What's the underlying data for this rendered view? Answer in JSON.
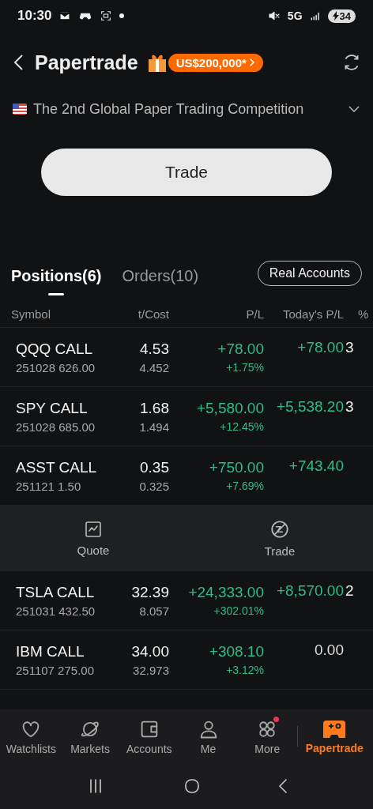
{
  "status_bar": {
    "time": "10:30",
    "network": "5G",
    "battery": "34"
  },
  "header": {
    "title": "Papertrade",
    "promo": "US$200,000*"
  },
  "competition": {
    "title": "The 2nd Global Paper Trading Competition"
  },
  "trade_button": "Trade",
  "tabs": [
    {
      "label": "Positions(6)",
      "selected": true
    },
    {
      "label": "Orders(10)",
      "selected": false
    }
  ],
  "real_accounts_button": "Real Accounts",
  "table": {
    "columns": [
      "Symbol",
      "t/Cost",
      "P/L",
      "Today's P/L",
      "%"
    ],
    "rows": [
      {
        "symbol": "QQQ CALL",
        "contract": "251028 626.00",
        "price": "4.53",
        "cost": "4.452",
        "pl": {
          "value": "+78.00",
          "percent": "+1.75%",
          "color": "#2dbd85"
        },
        "todays_pl": {
          "value": "+78.00",
          "color": "#2dbd85"
        },
        "column_5": "3",
        "expanded": false
      },
      {
        "symbol": "SPY CALL",
        "contract": "251028 685.00",
        "price": "1.68",
        "cost": "1.494",
        "pl": {
          "value": "+5,580.00",
          "percent": "+12.45%",
          "color": "#2dbd85"
        },
        "todays_pl": {
          "value": "+5,538.20",
          "color": "#2dbd85"
        },
        "column_5": "3",
        "expanded": false
      },
      {
        "symbol": "ASST CALL",
        "contract": "251121 1.50",
        "price": "0.35",
        "cost": "0.325",
        "pl": {
          "value": "+750.00",
          "percent": "+7.69%",
          "color": "#2dbd85"
        },
        "todays_pl": {
          "value": "+743.40",
          "color": "#2dbd85"
        },
        "expanded": true
      },
      {
        "symbol": "TSLA CALL",
        "contract": "251031 432.50",
        "price": "32.39",
        "cost": "8.057",
        "pl": {
          "value": "+24,333.00",
          "percent": "+302.01%",
          "color": "#2dbd85"
        },
        "todays_pl": {
          "value": "+8,570.00",
          "color": "#2dbd85"
        },
        "column_5": "2",
        "expanded": false
      },
      {
        "symbol": "IBM CALL",
        "contract": "251107 275.00",
        "price": "34.00",
        "cost": "32.973",
        "pl": {
          "value": "+308.10",
          "percent": "+3.12%",
          "color": "#2dbd85"
        },
        "todays_pl": {
          "value": "0.00",
          "color": "#dddddd"
        },
        "expanded": false
      }
    ],
    "row_actions": [
      {
        "label": "Quote",
        "kind": "quote"
      },
      {
        "label": "Trade",
        "kind": "trade"
      }
    ]
  },
  "bottom_nav": [
    {
      "label": "Watchlists",
      "kind": "heart",
      "selected": false,
      "badge": false
    },
    {
      "label": "Markets",
      "kind": "planet",
      "selected": false,
      "badge": false
    },
    {
      "label": "Accounts",
      "kind": "wallet",
      "selected": false,
      "badge": false
    },
    {
      "label": "Me",
      "kind": "person",
      "selected": false,
      "badge": false
    },
    {
      "label": "More",
      "kind": "grid",
      "selected": false,
      "badge": true
    },
    {
      "label": "Papertrade",
      "kind": "gamepad",
      "selected": true,
      "badge": false
    }
  ]
}
